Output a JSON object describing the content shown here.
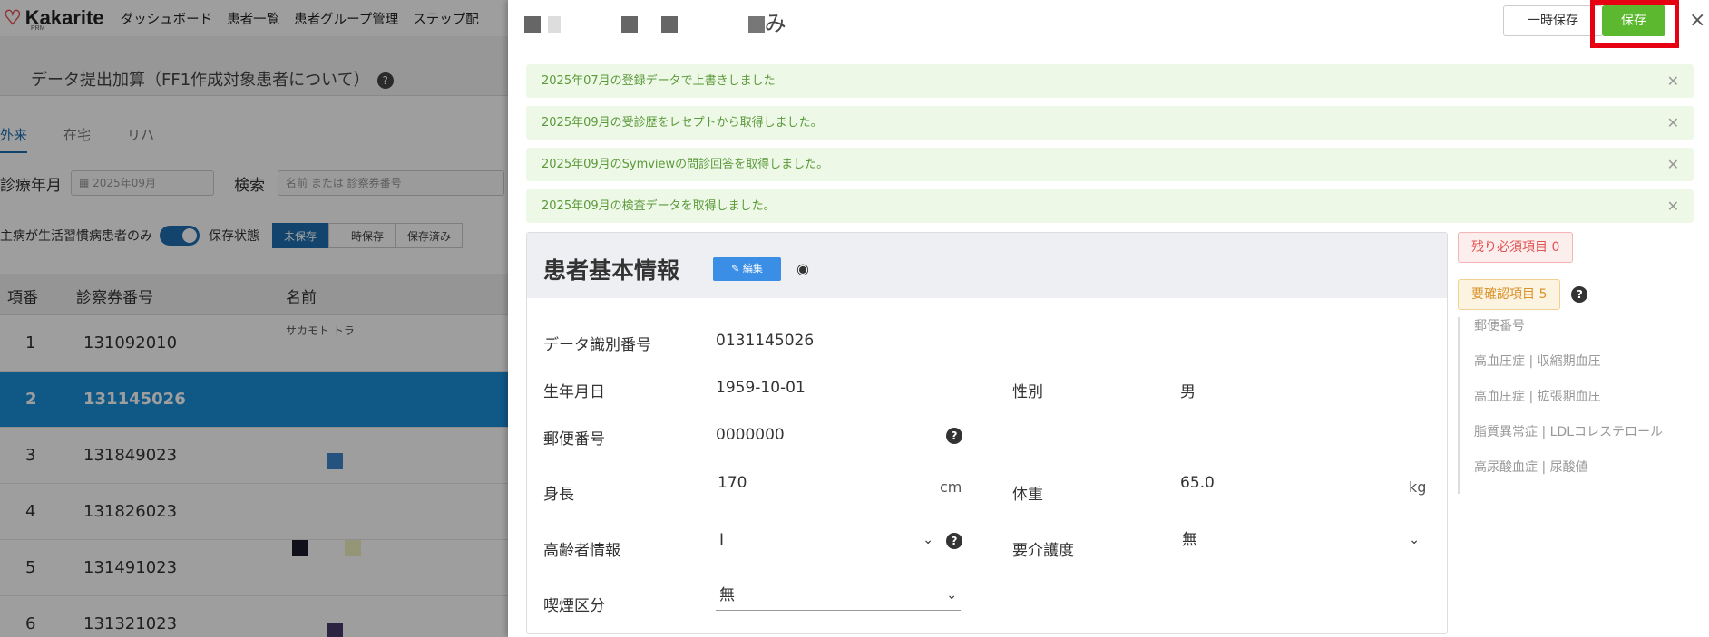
{
  "app": {
    "logo": "Kakarite",
    "logo_sub": "PRM",
    "nav": [
      "ダッシュボード",
      "患者一覧",
      "患者グループ管理",
      "ステップ配"
    ]
  },
  "page": {
    "title": "データ提出加算（FF1作成対象患者について）",
    "help_icon": "?"
  },
  "tabs": [
    "外来",
    "在宅",
    "リハ"
  ],
  "filters": {
    "month_label": "診療年月",
    "month_value": "2025年09月",
    "search_label": "検索",
    "search_placeholder": "名前 または 診察券番号",
    "lifestyle_label": "主病が生活習慣病患者のみ",
    "status_label": "保存状態",
    "status_options": [
      "未保存",
      "一時保存",
      "保存済み"
    ]
  },
  "table": {
    "headers": [
      "項番",
      "診察券番号",
      "名前"
    ],
    "rows": [
      {
        "no": "1",
        "id": "131092010",
        "kana": "サカモト トラ"
      },
      {
        "no": "2",
        "id": "131145026",
        "kana": ""
      },
      {
        "no": "3",
        "id": "131849023",
        "kana": ""
      },
      {
        "no": "4",
        "id": "131826023",
        "kana": ""
      },
      {
        "no": "5",
        "id": "131491023",
        "kana": ""
      },
      {
        "no": "6",
        "id": "131321023",
        "kana": ""
      }
    ]
  },
  "drawer": {
    "patient_name_tail": "み",
    "temp_save_label": "一時保存",
    "save_label": "保存",
    "close_icon": "×",
    "alerts": [
      "2025年07月の登録データで上書きしました",
      "2025年09月の受診歴をレセプトから取得しました。",
      "2025年09月のSymviewの問診回答を取得しました。",
      "2025年09月の検査データを取得しました。"
    ],
    "card": {
      "title": "患者基本情報",
      "edit_label": "編集",
      "fields": {
        "data_id_label": "データ識別番号",
        "data_id_value": "0131145026",
        "birth_label": "生年月日",
        "birth_value": "1959-10-01",
        "sex_label": "性別",
        "sex_value": "男",
        "zip_label": "郵便番号",
        "zip_value": "0000000",
        "height_label": "身長",
        "height_value": "170",
        "height_unit": "cm",
        "weight_label": "体重",
        "weight_value": "65.0",
        "weight_unit": "kg",
        "elderly_label": "高齢者情報",
        "elderly_value": "I",
        "care_label": "要介護度",
        "care_value": "無",
        "smoking_label": "喫煙区分",
        "smoking_value": "無"
      }
    },
    "side": {
      "required_remaining": "残り必須項目 0",
      "needs_check": "要確認項目 5",
      "check_items": [
        "郵便番号",
        "高血圧症 | 収縮期血圧",
        "高血圧症 | 拡張期血圧",
        "脂質異常症 | LDLコレステロール",
        "高尿酸血症 | 尿酸値"
      ]
    }
  },
  "colors": {
    "save_green": "#5cb82e",
    "highlight_red": "#e50012",
    "primary_blue": "#1a8fd8",
    "alert_green_bg": "#eef8e7"
  }
}
